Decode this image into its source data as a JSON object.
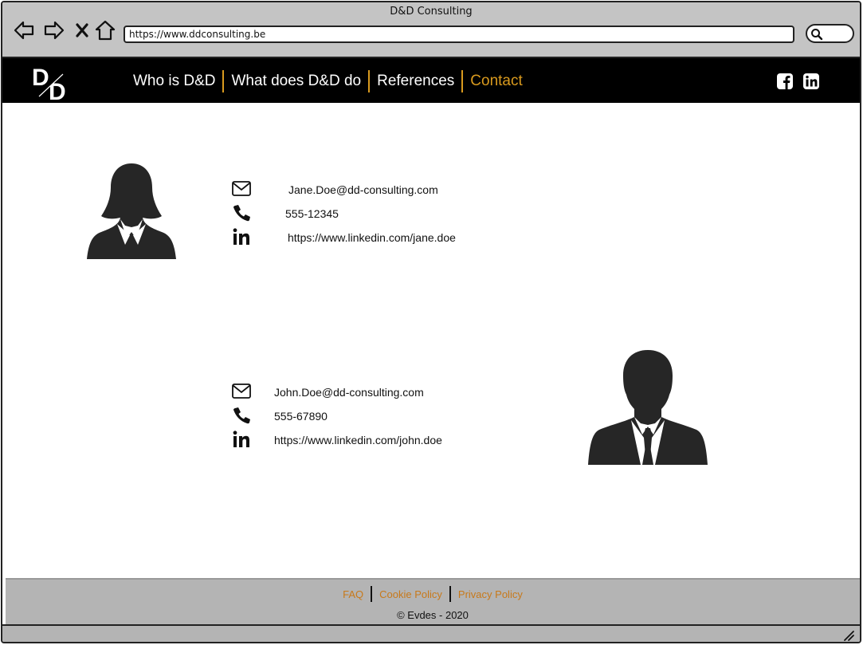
{
  "window": {
    "title": "D&D Consulting"
  },
  "browser": {
    "url": "https://www.ddconsulting.be",
    "icons": [
      "back-arrow-icon",
      "forward-arrow-icon",
      "close-x-icon",
      "home-icon",
      "search-icon"
    ]
  },
  "nav": {
    "logo": "D/D",
    "items": [
      {
        "label": "Who is D&D",
        "active": false
      },
      {
        "label": "What does D&D do",
        "active": false
      },
      {
        "label": "References",
        "active": false
      },
      {
        "label": "Contact",
        "active": true
      }
    ],
    "social": [
      "facebook-icon",
      "linkedin-icon"
    ]
  },
  "contacts": [
    {
      "avatar": "female-avatar",
      "email": "Jane.Doe@dd-consulting.com",
      "phone": "555-12345",
      "linkedin": "https://www.linkedin.com/jane.doe"
    },
    {
      "avatar": "male-avatar",
      "email": "John.Doe@dd-consulting.com",
      "phone": "555-67890",
      "linkedin": "https://www.linkedin.com/john.doe"
    }
  ],
  "footer": {
    "links": [
      "FAQ",
      "Cookie Policy",
      "Privacy Policy"
    ],
    "copyright": "© Evdes - 2020"
  },
  "colors": {
    "accent": "#d99a1e",
    "navbar": "#000000",
    "footer": "#b4b4b4",
    "footer_link": "#c8791a"
  }
}
